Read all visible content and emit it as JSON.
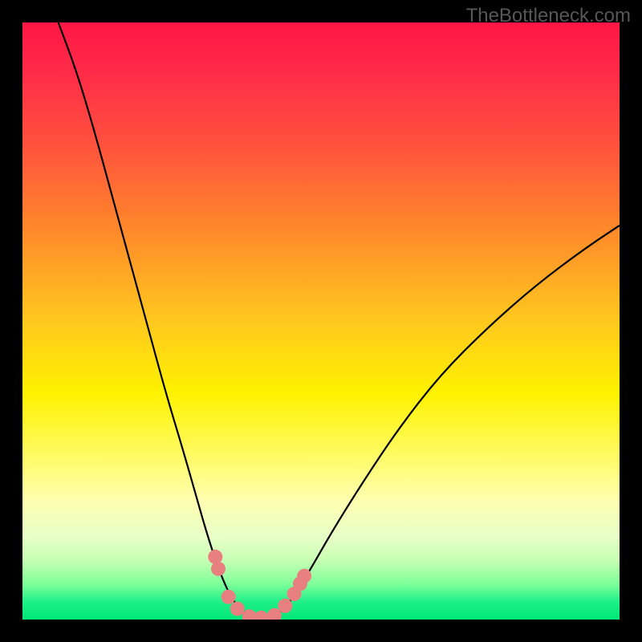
{
  "watermark": "TheBottleneck.com",
  "chart_data": {
    "type": "line",
    "title": "",
    "xlabel": "",
    "ylabel": "",
    "xlim": [
      0,
      100
    ],
    "ylim": [
      0,
      100
    ],
    "gradient_stops": [
      {
        "offset": 0.0,
        "color": "#ff1744"
      },
      {
        "offset": 0.08,
        "color": "#ff2a48"
      },
      {
        "offset": 0.2,
        "color": "#ff503e"
      },
      {
        "offset": 0.35,
        "color": "#ff8a2a"
      },
      {
        "offset": 0.5,
        "color": "#ffc81f"
      },
      {
        "offset": 0.62,
        "color": "#fff200"
      },
      {
        "offset": 0.72,
        "color": "#fffb60"
      },
      {
        "offset": 0.8,
        "color": "#ffffb0"
      },
      {
        "offset": 0.86,
        "color": "#e8ffc8"
      },
      {
        "offset": 0.9,
        "color": "#c8ffb4"
      },
      {
        "offset": 0.94,
        "color": "#80ff9a"
      },
      {
        "offset": 0.97,
        "color": "#20f088"
      },
      {
        "offset": 1.0,
        "color": "#00e878"
      }
    ],
    "series": [
      {
        "name": "bottleneck-curve",
        "color": "#000000",
        "width": 2.2,
        "points": [
          {
            "x": 6.0,
            "y": 100.0
          },
          {
            "x": 9.0,
            "y": 92.0
          },
          {
            "x": 12.0,
            "y": 82.0
          },
          {
            "x": 15.0,
            "y": 71.0
          },
          {
            "x": 18.0,
            "y": 60.0
          },
          {
            "x": 21.0,
            "y": 49.0
          },
          {
            "x": 24.0,
            "y": 38.0
          },
          {
            "x": 27.0,
            "y": 28.0
          },
          {
            "x": 29.0,
            "y": 21.0
          },
          {
            "x": 31.0,
            "y": 14.0
          },
          {
            "x": 33.0,
            "y": 8.0
          },
          {
            "x": 35.0,
            "y": 3.5
          },
          {
            "x": 37.0,
            "y": 1.2
          },
          {
            "x": 39.0,
            "y": 0.3
          },
          {
            "x": 41.0,
            "y": 0.2
          },
          {
            "x": 43.0,
            "y": 1.0
          },
          {
            "x": 45.0,
            "y": 3.2
          },
          {
            "x": 48.0,
            "y": 8.0
          },
          {
            "x": 52.0,
            "y": 15.0
          },
          {
            "x": 57.0,
            "y": 23.0
          },
          {
            "x": 63.0,
            "y": 32.0
          },
          {
            "x": 70.0,
            "y": 41.0
          },
          {
            "x": 78.0,
            "y": 49.0
          },
          {
            "x": 86.0,
            "y": 56.0
          },
          {
            "x": 94.0,
            "y": 62.0
          },
          {
            "x": 100.0,
            "y": 66.0
          }
        ]
      },
      {
        "name": "highlighted-points",
        "type": "scatter",
        "color": "#e88080",
        "radius": 9,
        "points": [
          {
            "x": 32.3,
            "y": 10.5
          },
          {
            "x": 32.8,
            "y": 8.5
          },
          {
            "x": 34.5,
            "y": 3.8
          },
          {
            "x": 36.0,
            "y": 1.8
          },
          {
            "x": 38.0,
            "y": 0.5
          },
          {
            "x": 40.0,
            "y": 0.3
          },
          {
            "x": 42.2,
            "y": 0.7
          },
          {
            "x": 44.0,
            "y": 2.3
          },
          {
            "x": 45.5,
            "y": 4.3
          },
          {
            "x": 46.5,
            "y": 6.0
          },
          {
            "x": 47.2,
            "y": 7.3
          }
        ]
      }
    ]
  }
}
